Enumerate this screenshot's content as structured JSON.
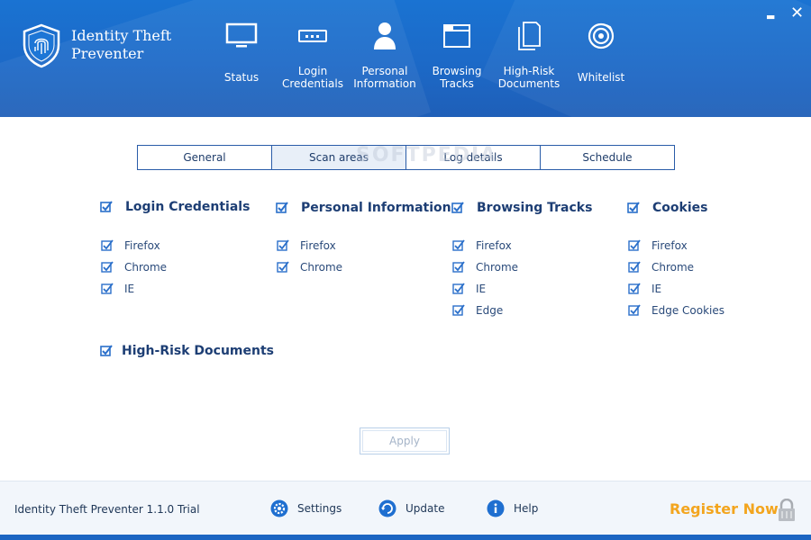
{
  "app": {
    "title_line1": "Identity Theft",
    "title_line2": "Preventer",
    "version": "Identity Theft Preventer 1.1.0 Trial"
  },
  "window_controls": {
    "minimize": "▬",
    "close": "✕"
  },
  "nav": [
    {
      "label": "Status",
      "icon": "monitor-icon"
    },
    {
      "label1": "Login",
      "label2": "Credentials",
      "icon": "password-field-icon"
    },
    {
      "label1": "Personal",
      "label2": "Information",
      "icon": "person-icon"
    },
    {
      "label1": "Browsing",
      "label2": "Tracks",
      "icon": "browser-window-icon"
    },
    {
      "label1": "High-Risk",
      "label2": "Documents",
      "icon": "documents-icon"
    },
    {
      "label": "Whitelist",
      "icon": "target-icon"
    }
  ],
  "tabs": [
    {
      "label": "General"
    },
    {
      "label": "Scan areas",
      "active": true
    },
    {
      "label": "Log details"
    },
    {
      "label": "Schedule"
    }
  ],
  "watermark": "SOFTPEDIA",
  "groups": {
    "login": {
      "title": "Login Credentials",
      "checked": true,
      "items": [
        "Firefox",
        "Chrome",
        "IE"
      ]
    },
    "personal": {
      "title": "Personal Information",
      "checked": true,
      "items": [
        "Firefox",
        "Chrome"
      ]
    },
    "browsing": {
      "title": "Browsing Tracks",
      "checked": true,
      "items": [
        "Firefox",
        "Chrome",
        "IE",
        "Edge"
      ]
    },
    "cookies": {
      "title": "Cookies",
      "checked": true,
      "items": [
        "Firefox",
        "Chrome",
        "IE",
        "Edge Cookies"
      ]
    },
    "highrisk": {
      "title": "High-Risk Documents",
      "checked": true
    }
  },
  "apply_label": "Apply",
  "footer": {
    "settings": "Settings",
    "update": "Update",
    "help": "Help",
    "register": "Register Now"
  },
  "colors": {
    "header": "#1c69c7",
    "accent_text": "#1d3e74",
    "register": "#f3a51e",
    "checkbox": "#2a6fca"
  }
}
